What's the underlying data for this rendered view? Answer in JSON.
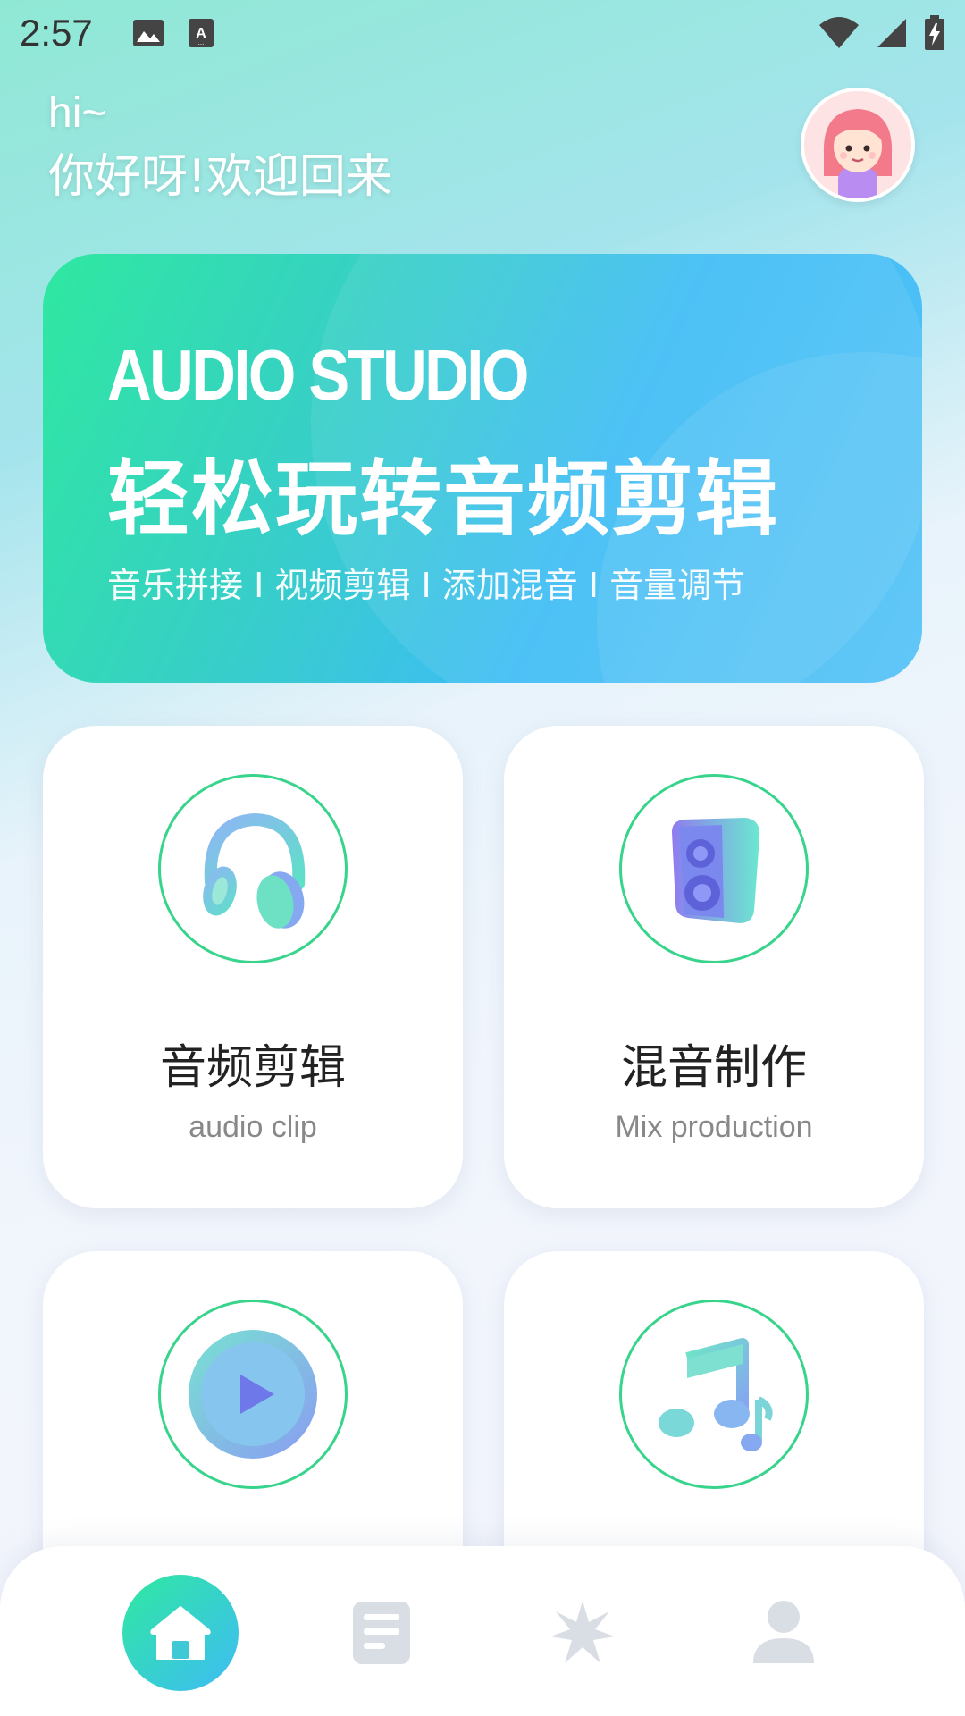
{
  "status_bar": {
    "time": "2:57",
    "icons_left": [
      "image-icon",
      "keyboard-a-icon"
    ],
    "icons_right": [
      "wifi-icon",
      "signal-icon",
      "battery-charging-icon"
    ]
  },
  "greeting": {
    "hi": "hi~",
    "welcome": "你好呀!欢迎回来"
  },
  "banner": {
    "title": "AUDIO STUDIO",
    "headline": "轻松玩转音频剪辑",
    "subtitle": "音乐拼接 I 视频剪辑 I 添加混音 I 音量调节"
  },
  "cards": [
    {
      "title": "音频剪辑",
      "subtitle": "audio clip",
      "icon": "headphones-icon"
    },
    {
      "title": "混音制作",
      "subtitle": "Mix production",
      "icon": "speaker-icon"
    },
    {
      "title": "",
      "subtitle": "",
      "icon": "play-icon"
    },
    {
      "title": "",
      "subtitle": "",
      "icon": "music-note-icon"
    }
  ],
  "bottom_nav": [
    {
      "label": "home",
      "icon": "home-icon",
      "active": true
    },
    {
      "label": "files",
      "icon": "document-icon",
      "active": false
    },
    {
      "label": "effects",
      "icon": "sparkle-icon",
      "active": false
    },
    {
      "label": "profile",
      "icon": "user-icon",
      "active": false
    }
  ],
  "colors": {
    "accent_green": "#2fe8a0",
    "accent_blue": "#3ebcf5",
    "ring": "#38d48b",
    "nav_inactive": "#d9dde4"
  }
}
